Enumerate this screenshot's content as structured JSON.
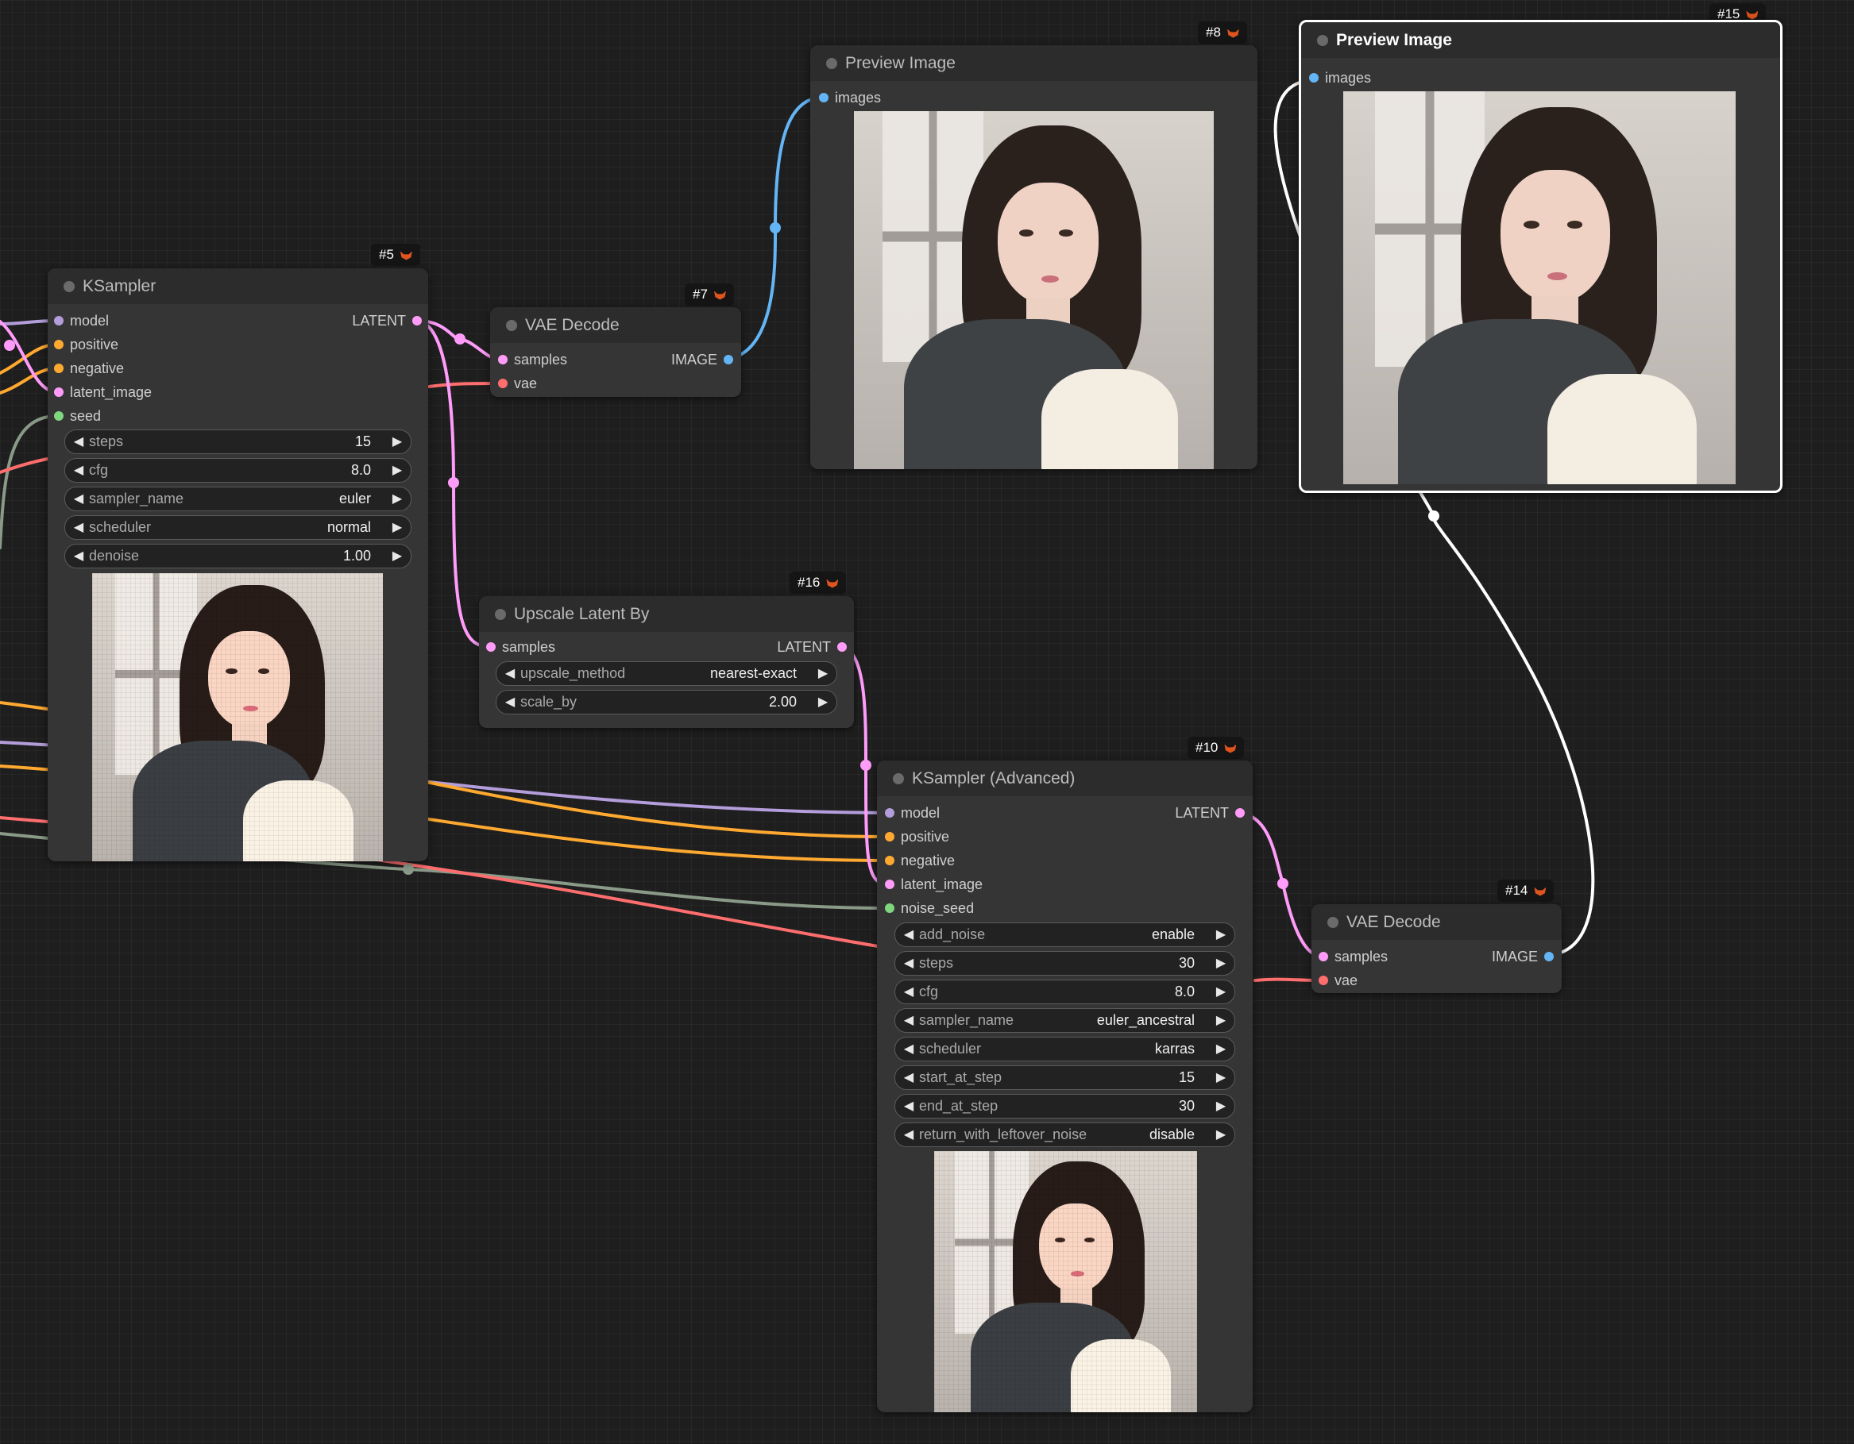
{
  "colors": {
    "model": "#b39ddb",
    "clip": "#ffa931",
    "latent": "#ff9cf9",
    "image": "#64b5f6",
    "vae": "#ff6e6e",
    "int": "#7fd67f",
    "wire_seed": "#8a9a88",
    "selected_border": "#ffffff"
  },
  "nodes": {
    "ksampler": {
      "title": "KSampler",
      "badge": "#5",
      "inputs": [
        "model",
        "positive",
        "negative",
        "latent_image",
        "seed"
      ],
      "output": "LATENT",
      "widgets": [
        {
          "label": "steps",
          "value": "15"
        },
        {
          "label": "cfg",
          "value": "8.0"
        },
        {
          "label": "sampler_name",
          "value": "euler"
        },
        {
          "label": "scheduler",
          "value": "normal"
        },
        {
          "label": "denoise",
          "value": "1.00"
        }
      ]
    },
    "vae_decode_7": {
      "title": "VAE Decode",
      "badge": "#7",
      "inputs": [
        "samples",
        "vae"
      ],
      "output": "IMAGE"
    },
    "preview_8": {
      "title": "Preview Image",
      "badge": "#8",
      "inputs": [
        "images"
      ]
    },
    "preview_15": {
      "title": "Preview Image",
      "badge": "#15",
      "inputs": [
        "images"
      ]
    },
    "upscale_16": {
      "title": "Upscale Latent By",
      "badge": "#16",
      "inputs": [
        "samples"
      ],
      "output": "LATENT",
      "widgets": [
        {
          "label": "upscale_method",
          "value": "nearest-exact"
        },
        {
          "label": "scale_by",
          "value": "2.00"
        }
      ]
    },
    "ksampler_adv_10": {
      "title": "KSampler (Advanced)",
      "badge": "#10",
      "inputs": [
        "model",
        "positive",
        "negative",
        "latent_image",
        "noise_seed"
      ],
      "output": "LATENT",
      "widgets": [
        {
          "label": "add_noise",
          "value": "enable"
        },
        {
          "label": "steps",
          "value": "30"
        },
        {
          "label": "cfg",
          "value": "8.0"
        },
        {
          "label": "sampler_name",
          "value": "euler_ancestral"
        },
        {
          "label": "scheduler",
          "value": "karras"
        },
        {
          "label": "start_at_step",
          "value": "15"
        },
        {
          "label": "end_at_step",
          "value": "30"
        },
        {
          "label": "return_with_leftover_noise",
          "value": "disable"
        }
      ]
    },
    "vae_decode_14": {
      "title": "VAE Decode",
      "badge": "#14",
      "inputs": [
        "samples",
        "vae"
      ],
      "output": "IMAGE"
    }
  },
  "icons": {
    "badge_icon": "fox-icon",
    "widget_left": "decrement-arrow-icon",
    "widget_right": "increment-arrow-icon"
  }
}
